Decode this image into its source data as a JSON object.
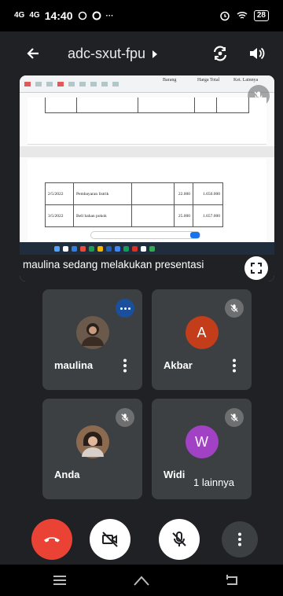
{
  "status_bar": {
    "signal_1": "4G",
    "signal_2": "4G",
    "time": "14:40",
    "extra": "···",
    "battery": "28"
  },
  "meeting": {
    "code": "adc-sxut-fpu"
  },
  "presentation": {
    "caption": "maulina sedang melakukan presentasi",
    "document": {
      "header_columns": [
        "Barang",
        "Harga Total",
        "Ket. Lainnya"
      ],
      "rows": [
        {
          "date": "2/5/2022",
          "item": "Pembayaran listrik",
          "qty": "22.000",
          "total": "1.650.000"
        },
        {
          "date": "3/5/2022",
          "item": "Beli bahan pokok",
          "qty": "25.000",
          "total": "1.657.000"
        }
      ]
    }
  },
  "participants": [
    {
      "name": "maulina",
      "initial": "",
      "avatar_color": "#5a4a3e",
      "state": "speaking"
    },
    {
      "name": "Akbar",
      "initial": "A",
      "avatar_color": "#c43d1a",
      "state": "muted"
    },
    {
      "name": "Anda",
      "initial": "",
      "avatar_color": "#6b4e3d",
      "state": "muted"
    },
    {
      "name": "Widi",
      "initial": "W",
      "avatar_color": "#a142c4",
      "state": "muted"
    }
  ],
  "overflow_label": "1 lainnya",
  "colors": {
    "end_call": "#ea4335",
    "control_light": "#ffffff",
    "tile_bg": "#3c4043",
    "app_bg": "#202124"
  }
}
